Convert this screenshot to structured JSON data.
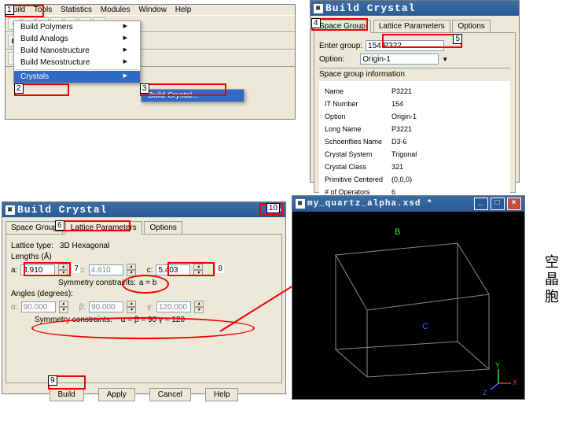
{
  "annotations": {
    "n1": "1",
    "n2": "2",
    "n3": "3",
    "n4": "4",
    "n5": "5",
    "n6": "6",
    "n7": "7",
    "n8": "8",
    "n9": "9",
    "n10": "10"
  },
  "cjk_label": "空\n晶\n胞",
  "topLeft": {
    "menus": {
      "build": "Build",
      "tools": "Tools",
      "statistics": "Statistics",
      "modules": "Modules",
      "window": "Window",
      "help": "Help"
    },
    "dropdown": {
      "polymers": "Build Polymers",
      "analogs": "Build Analogs",
      "nano": "Build Nanostructure",
      "meso": "Build Mesostructure",
      "crystals": "Crystals",
      "build_crystal": "Build Crystal..."
    }
  },
  "topRight": {
    "title": "Build Crystal",
    "tabs": {
      "sg": "Space Group",
      "lp": "Lattice Parameters",
      "opt": "Options"
    },
    "enter_group": "Enter group:",
    "enter_group_val": "154 P322",
    "option": "Option:",
    "option_val": "Origin-1",
    "info_header": "Space group information",
    "info": {
      "name_l": "Name",
      "name_v": "P3221",
      "itnum_l": "IT Number",
      "itnum_v": "154",
      "option_l": "Option",
      "option_v": "Origin-1",
      "long_l": "Long Name",
      "long_v": "P3221",
      "scho_l": "Schoenflies Name",
      "scho_v": "D3-6",
      "sys_l": "Crystal System",
      "sys_v": "Trigonal",
      "class_l": "Crystal Class",
      "class_v": "321",
      "prim_l": "Primitive Centered",
      "prim_v": "(0,0,0)",
      "ops_l": "# of Operators",
      "ops_v": "6"
    }
  },
  "bottomLeft": {
    "title": "Build Crystal",
    "tabs": {
      "sg": "Space Group",
      "lp": "Lattice Parameters",
      "opt": "Options"
    },
    "lattice_type_l": "Lattice type:",
    "lattice_type_v": "3D Hexagonal",
    "lengths_header": "Lengths (Å)",
    "a_l": "a:",
    "a_v": "4.910",
    "b_l": "b:",
    "b_v": "4.910",
    "c_l": "c:",
    "c_v": "5.403",
    "sym_ab_l": "Symmetry constraints:",
    "sym_ab_v": "a = b",
    "angles_header": "Angles (degrees):",
    "al_l": "α:",
    "al_v": "90.000",
    "be_l": "β:",
    "be_v": "90.000",
    "ga_l": "γ:",
    "ga_v": "120.000",
    "sym_ang_v": "α = β = 90  γ = 120",
    "btn_build": "Build",
    "btn_apply": "Apply",
    "btn_cancel": "Cancel",
    "btn_help": "Help"
  },
  "viewer": {
    "title": "my_quartz_alpha.xsd *",
    "axis_b": "B",
    "axis_c": "C",
    "axis_x": "X",
    "axis_y": "Y",
    "axis_z": "Z"
  }
}
